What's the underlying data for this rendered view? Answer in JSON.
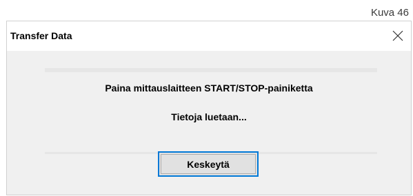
{
  "figure_label": "Kuva 46",
  "dialog": {
    "title": "Transfer Data",
    "instruction": "Paina mittauslaitteen START/STOP-painiketta",
    "status": "Tietoja luetaan...",
    "cancel_label": "Keskeytä",
    "close_icon": "close-icon"
  },
  "progress_top": 0,
  "progress_bottom": 0,
  "colors": {
    "accent": "#0078d7",
    "dialog_bg": "#f0f0f0",
    "progress_track": "#e6e6e6"
  }
}
